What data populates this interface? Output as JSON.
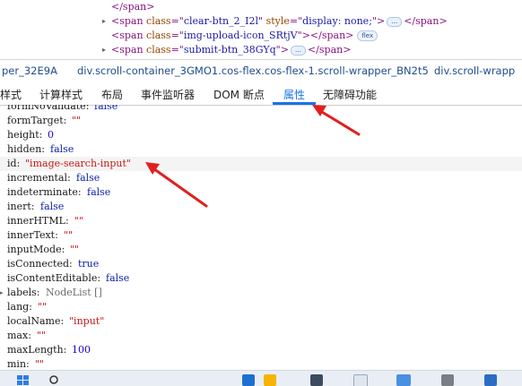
{
  "dom_lines": [
    {
      "tri": "",
      "parts": [
        {
          "c": "tag",
          "t": "</span>"
        }
      ]
    },
    {
      "tri": "▸",
      "parts": [
        {
          "c": "tag",
          "t": "<span "
        },
        {
          "c": "attr",
          "t": "class"
        },
        {
          "c": "tag",
          "t": "=\""
        },
        {
          "c": "val",
          "t": "clear-btn_2_I2l"
        },
        {
          "c": "tag",
          "t": "\" "
        },
        {
          "c": "attr",
          "t": "style"
        },
        {
          "c": "tag",
          "t": "=\""
        },
        {
          "c": "val",
          "t": "display: none;"
        },
        {
          "c": "tag",
          "t": "\">"
        }
      ],
      "ellipsis": true,
      "tail": "</span>"
    },
    {
      "tri": "",
      "parts": [
        {
          "c": "tag",
          "t": "<span "
        },
        {
          "c": "attr",
          "t": "class"
        },
        {
          "c": "tag",
          "t": "=\""
        },
        {
          "c": "val",
          "t": "img-upload-icon_SRtjV"
        },
        {
          "c": "tag",
          "t": "\"></span>"
        }
      ],
      "badge": "flex"
    },
    {
      "tri": "▸",
      "parts": [
        {
          "c": "tag",
          "t": "<span "
        },
        {
          "c": "attr",
          "t": "class"
        },
        {
          "c": "tag",
          "t": "=\""
        },
        {
          "c": "val",
          "t": "submit-btn_38GYq"
        },
        {
          "c": "tag",
          "t": "\">"
        }
      ],
      "ellipsis": true,
      "tail": "</span>"
    }
  ],
  "breadcrumbs": [
    "per_32E9A",
    "div.scroll-container_3GMO1.cos-flex.cos-flex-1.scroll-wrapper_BN2t5",
    "div.scroll-wrapp"
  ],
  "tabs": [
    "样式",
    "计算样式",
    "布局",
    "事件监听器",
    "DOM 断点",
    "属性",
    "无障碍功能"
  ],
  "active_tab": "属性",
  "properties": [
    {
      "k": "formNoValidate",
      "v": "false",
      "t": "kw"
    },
    {
      "k": "formTarget",
      "v": "\"\"",
      "t": "str"
    },
    {
      "k": "height",
      "v": "0",
      "t": "num"
    },
    {
      "k": "hidden",
      "v": "false",
      "t": "kw"
    },
    {
      "k": "id",
      "v": "\"image-search-input\"",
      "t": "str",
      "hl": true
    },
    {
      "k": "incremental",
      "v": "false",
      "t": "kw"
    },
    {
      "k": "indeterminate",
      "v": "false",
      "t": "kw"
    },
    {
      "k": "inert",
      "v": "false",
      "t": "kw"
    },
    {
      "k": "innerHTML",
      "v": "\"\"",
      "t": "str"
    },
    {
      "k": "innerText",
      "v": "\"\"",
      "t": "str"
    },
    {
      "k": "inputMode",
      "v": "\"\"",
      "t": "str"
    },
    {
      "k": "isConnected",
      "v": "true",
      "t": "kw"
    },
    {
      "k": "isContentEditable",
      "v": "false",
      "t": "kw"
    },
    {
      "k": "labels",
      "v": "NodeList  []",
      "t": "obj",
      "expand": true
    },
    {
      "k": "lang",
      "v": "\"\"",
      "t": "str"
    },
    {
      "k": "localName",
      "v": "\"input\"",
      "t": "str"
    },
    {
      "k": "max",
      "v": "\"\"",
      "t": "str"
    },
    {
      "k": "maxLength",
      "v": "100",
      "t": "num"
    },
    {
      "k": "min",
      "v": "\"\"",
      "t": "str"
    }
  ],
  "colors": {
    "accent": "#1a73e8",
    "arrow": "#e02020",
    "string": "#c41a16",
    "keyword": "#0d22aa"
  },
  "taskbar_icons": [
    "windows-start-icon",
    "search-icon",
    "widget-icon",
    "task-view-icon",
    "folder-icon",
    "app-icon",
    "app-icon-2",
    "app-icon-3"
  ]
}
